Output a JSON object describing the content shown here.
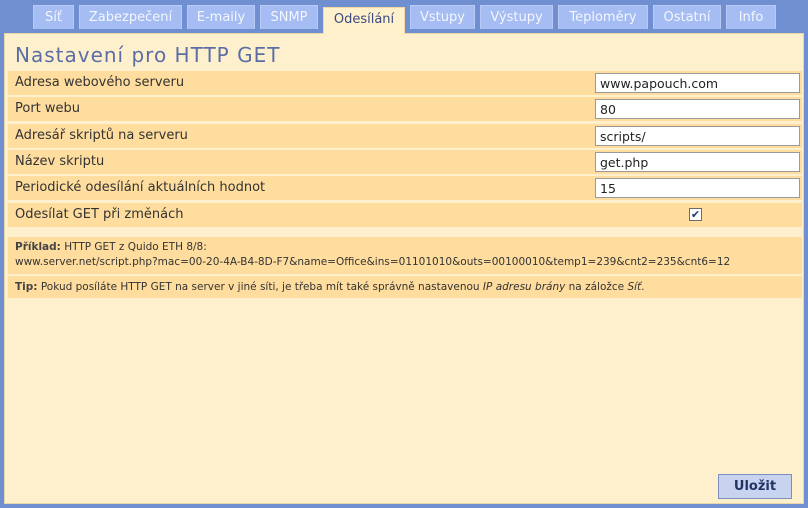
{
  "tabs": [
    {
      "label": "Síť"
    },
    {
      "label": "Zabezpečení"
    },
    {
      "label": "E-maily"
    },
    {
      "label": "SNMP"
    },
    {
      "label": "Odesílání"
    },
    {
      "label": "Vstupy"
    },
    {
      "label": "Výstupy"
    },
    {
      "label": "Teploměry"
    },
    {
      "label": "Ostatní"
    },
    {
      "label": "Info"
    }
  ],
  "active_tab": "Odesílání",
  "page_title": "Nastavení pro HTTP GET",
  "fields": [
    {
      "label": "Adresa webového serveru",
      "value": "www.papouch.com"
    },
    {
      "label": "Port webu",
      "value": "80"
    },
    {
      "label": "Adresář skriptů na serveru",
      "value": "scripts/"
    },
    {
      "label": "Název skriptu",
      "value": "get.php"
    },
    {
      "label": "Periodické odesílání aktuálních hodnot",
      "value": "15"
    }
  ],
  "send_on_change": {
    "label": "Odesílat GET při změnách",
    "checked": true
  },
  "example": {
    "heading": "Příklad:",
    "text": "HTTP GET z Quido ETH 8/8:",
    "url": "www.server.net/script.php?mac=00-20-4A-B4-8D-F7&name=Office&ins=01101010&outs=00100010&temp1=239&cnt2=235&cnt6=12"
  },
  "tip": {
    "heading": "Tip:",
    "text_before": "Pokud posíláte HTTP GET na server v jiné síti, je třeba mít také správně nastavenou",
    "link_text": "IP adresu brány",
    "text_middle": "na záložce",
    "tab_ref": "Síť",
    "text_after": "."
  },
  "save_button": "Uložit",
  "colors": {
    "background": "#6f8fd0",
    "tab": "#a5bdf2",
    "panel": "#fff0cd",
    "row": "#ffdd9e",
    "title": "#5a6ea6"
  }
}
